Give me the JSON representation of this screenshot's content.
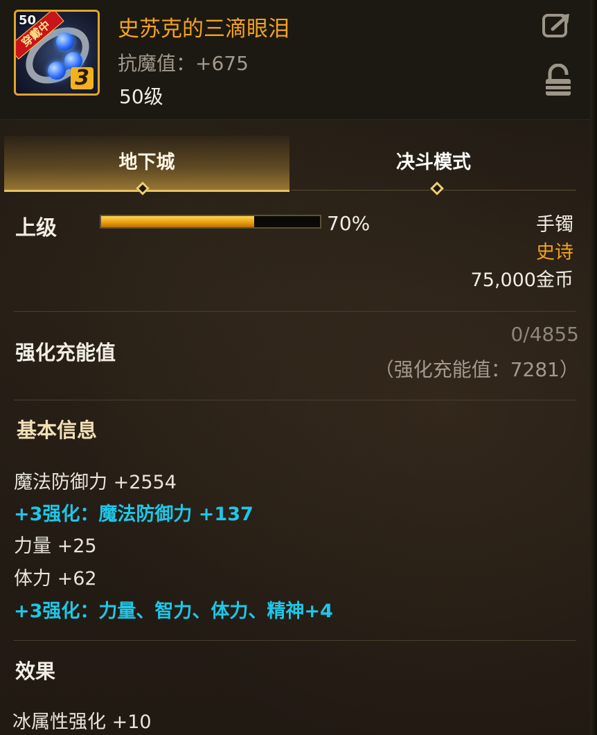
{
  "item": {
    "name": "史苏克的三滴眼泪",
    "stat": "抗魔值：+675",
    "level": "50级",
    "icon_level_badge": "50",
    "wearing_tag": "穿戴中",
    "grade_badge": "3"
  },
  "header_actions": {
    "share_icon": "share-icon",
    "lock_icon": "lock-icon"
  },
  "tabs": [
    {
      "label": "地下城",
      "active": true
    },
    {
      "label": "决斗模式",
      "active": false
    }
  ],
  "upgrade": {
    "label": "上级",
    "percent_text": "70%",
    "percent": 0.7
  },
  "meta": {
    "type": "手镯",
    "rarity": "史诗",
    "price": "75,000金币"
  },
  "charge": {
    "label": "强化充能值",
    "progress": "0/4855",
    "total": "（强化充能值：7281）"
  },
  "basic_info": {
    "title": "基本信息",
    "lines": [
      {
        "text": "魔法防御力 +2554",
        "style": "white"
      },
      {
        "text": "+3强化：魔法防御力 +137",
        "style": "cyan"
      },
      {
        "text": "力量 +25",
        "style": "white"
      },
      {
        "text": "体力 +62",
        "style": "white"
      },
      {
        "text": "+3强化：力量、智力、体力、精神+4",
        "style": "cyan"
      }
    ]
  },
  "effects": {
    "title": "效果",
    "lines": [
      {
        "text": "冰属性强化 +10",
        "style": "white"
      }
    ]
  },
  "colors": {
    "gold": "#f4a31c",
    "cyan": "#1ec7e8",
    "panel_bg": "#1f1a14"
  }
}
